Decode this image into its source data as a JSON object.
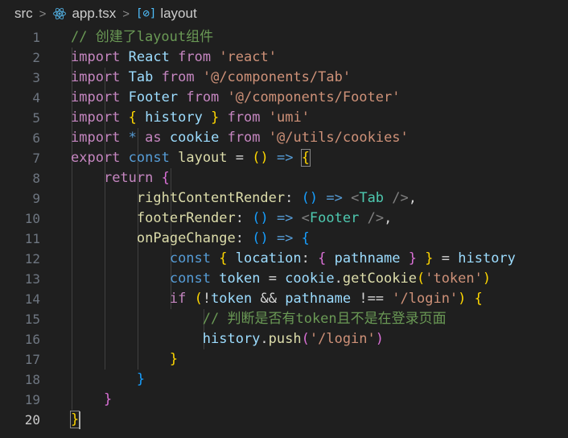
{
  "breadcrumb": {
    "folder": "src",
    "file": "app.tsx",
    "symbol": "layout"
  },
  "active_line": 20,
  "lines": [
    {
      "n": "1",
      "tokens": [
        [
          "c",
          "// 创建了layout组件"
        ]
      ]
    },
    {
      "n": "2",
      "tokens": [
        [
          "kw",
          "import"
        ],
        [
          "o",
          " "
        ],
        [
          "v",
          "React"
        ],
        [
          "o",
          " "
        ],
        [
          "kw",
          "from"
        ],
        [
          "o",
          " "
        ],
        [
          "s",
          "'react'"
        ]
      ]
    },
    {
      "n": "3",
      "tokens": [
        [
          "kw",
          "import"
        ],
        [
          "o",
          " "
        ],
        [
          "v",
          "Tab"
        ],
        [
          "o",
          " "
        ],
        [
          "kw",
          "from"
        ],
        [
          "o",
          " "
        ],
        [
          "s",
          "'@/components/Tab'"
        ]
      ]
    },
    {
      "n": "4",
      "tokens": [
        [
          "kw",
          "import"
        ],
        [
          "o",
          " "
        ],
        [
          "v",
          "Footer"
        ],
        [
          "o",
          " "
        ],
        [
          "kw",
          "from"
        ],
        [
          "o",
          " "
        ],
        [
          "s",
          "'@/components/Footer'"
        ]
      ]
    },
    {
      "n": "5",
      "tokens": [
        [
          "kw",
          "import"
        ],
        [
          "o",
          " "
        ],
        [
          "b1",
          "{"
        ],
        [
          "o",
          " "
        ],
        [
          "v",
          "history"
        ],
        [
          "o",
          " "
        ],
        [
          "b1",
          "}"
        ],
        [
          "o",
          " "
        ],
        [
          "kw",
          "from"
        ],
        [
          "o",
          " "
        ],
        [
          "s",
          "'umi'"
        ]
      ]
    },
    {
      "n": "6",
      "tokens": [
        [
          "kw",
          "import"
        ],
        [
          "o",
          " "
        ],
        [
          "kb",
          "*"
        ],
        [
          "o",
          " "
        ],
        [
          "kw",
          "as"
        ],
        [
          "o",
          " "
        ],
        [
          "v",
          "cookie"
        ],
        [
          "o",
          " "
        ],
        [
          "kw",
          "from"
        ],
        [
          "o",
          " "
        ],
        [
          "s",
          "'@/utils/cookies'"
        ]
      ]
    },
    {
      "n": "7",
      "tokens": [
        [
          "kw",
          "export"
        ],
        [
          "o",
          " "
        ],
        [
          "kb",
          "const"
        ],
        [
          "o",
          " "
        ],
        [
          "f",
          "layout"
        ],
        [
          "o",
          " = "
        ],
        [
          "b1",
          "()"
        ],
        [
          "o",
          " "
        ],
        [
          "kb",
          "=>"
        ],
        [
          "o",
          " "
        ],
        [
          "b1 boxed",
          "{"
        ]
      ]
    },
    {
      "n": "8",
      "tokens": [
        [
          "o",
          "    "
        ],
        [
          "kw",
          "return"
        ],
        [
          "o",
          " "
        ],
        [
          "b2",
          "{"
        ]
      ]
    },
    {
      "n": "9",
      "tokens": [
        [
          "o",
          "        "
        ],
        [
          "f",
          "rightContentRender"
        ],
        [
          "o",
          ": "
        ],
        [
          "b3",
          "()"
        ],
        [
          "o",
          " "
        ],
        [
          "kb",
          "=>"
        ],
        [
          "o",
          " "
        ],
        [
          "tg",
          "<"
        ],
        [
          "t",
          "Tab"
        ],
        [
          "o",
          " "
        ],
        [
          "tg",
          "/>"
        ],
        [
          "o",
          ","
        ]
      ]
    },
    {
      "n": "10",
      "tokens": [
        [
          "o",
          "        "
        ],
        [
          "f",
          "footerRender"
        ],
        [
          "o",
          ": "
        ],
        [
          "b3",
          "()"
        ],
        [
          "o",
          " "
        ],
        [
          "kb",
          "=>"
        ],
        [
          "o",
          " "
        ],
        [
          "tg",
          "<"
        ],
        [
          "t",
          "Footer"
        ],
        [
          "o",
          " "
        ],
        [
          "tg",
          "/>"
        ],
        [
          "o",
          ","
        ]
      ]
    },
    {
      "n": "11",
      "tokens": [
        [
          "o",
          "        "
        ],
        [
          "f",
          "onPageChange"
        ],
        [
          "o",
          ": "
        ],
        [
          "b3",
          "()"
        ],
        [
          "o",
          " "
        ],
        [
          "kb",
          "=>"
        ],
        [
          "o",
          " "
        ],
        [
          "b3",
          "{"
        ]
      ]
    },
    {
      "n": "12",
      "tokens": [
        [
          "o",
          "            "
        ],
        [
          "kb",
          "const"
        ],
        [
          "o",
          " "
        ],
        [
          "b1",
          "{"
        ],
        [
          "o",
          " "
        ],
        [
          "v",
          "location"
        ],
        [
          "o",
          ": "
        ],
        [
          "b2",
          "{"
        ],
        [
          "o",
          " "
        ],
        [
          "v",
          "pathname"
        ],
        [
          "o",
          " "
        ],
        [
          "b2",
          "}"
        ],
        [
          "o",
          " "
        ],
        [
          "b1",
          "}"
        ],
        [
          "o",
          " = "
        ],
        [
          "v",
          "history"
        ]
      ]
    },
    {
      "n": "13",
      "tokens": [
        [
          "o",
          "            "
        ],
        [
          "kb",
          "const"
        ],
        [
          "o",
          " "
        ],
        [
          "v",
          "token"
        ],
        [
          "o",
          " = "
        ],
        [
          "v",
          "cookie"
        ],
        [
          "o",
          "."
        ],
        [
          "f",
          "getCookie"
        ],
        [
          "b1",
          "("
        ],
        [
          "s",
          "'token'"
        ],
        [
          "b1",
          ")"
        ]
      ]
    },
    {
      "n": "14",
      "tokens": [
        [
          "o",
          "            "
        ],
        [
          "kw",
          "if"
        ],
        [
          "o",
          " "
        ],
        [
          "b1",
          "("
        ],
        [
          "o",
          "!"
        ],
        [
          "v",
          "token"
        ],
        [
          "o",
          " && "
        ],
        [
          "v",
          "pathname"
        ],
        [
          "o",
          " !== "
        ],
        [
          "s",
          "'/login'"
        ],
        [
          "b1",
          ")"
        ],
        [
          "o",
          " "
        ],
        [
          "b1",
          "{"
        ]
      ]
    },
    {
      "n": "15",
      "tokens": [
        [
          "o",
          "                "
        ],
        [
          "c",
          "// 判断是否有token且不是在登录页面"
        ]
      ]
    },
    {
      "n": "16",
      "tokens": [
        [
          "o",
          "                "
        ],
        [
          "v",
          "history"
        ],
        [
          "o",
          "."
        ],
        [
          "f",
          "push"
        ],
        [
          "b2",
          "("
        ],
        [
          "s",
          "'/login'"
        ],
        [
          "b2",
          ")"
        ]
      ]
    },
    {
      "n": "17",
      "tokens": [
        [
          "o",
          "            "
        ],
        [
          "b1",
          "}"
        ]
      ]
    },
    {
      "n": "18",
      "tokens": [
        [
          "o",
          "        "
        ],
        [
          "b3",
          "}"
        ]
      ]
    },
    {
      "n": "19",
      "tokens": [
        [
          "o",
          "    "
        ],
        [
          "b2",
          "}"
        ]
      ]
    },
    {
      "n": "20",
      "tokens": [
        [
          "b1 boxed",
          "}"
        ]
      ]
    }
  ]
}
